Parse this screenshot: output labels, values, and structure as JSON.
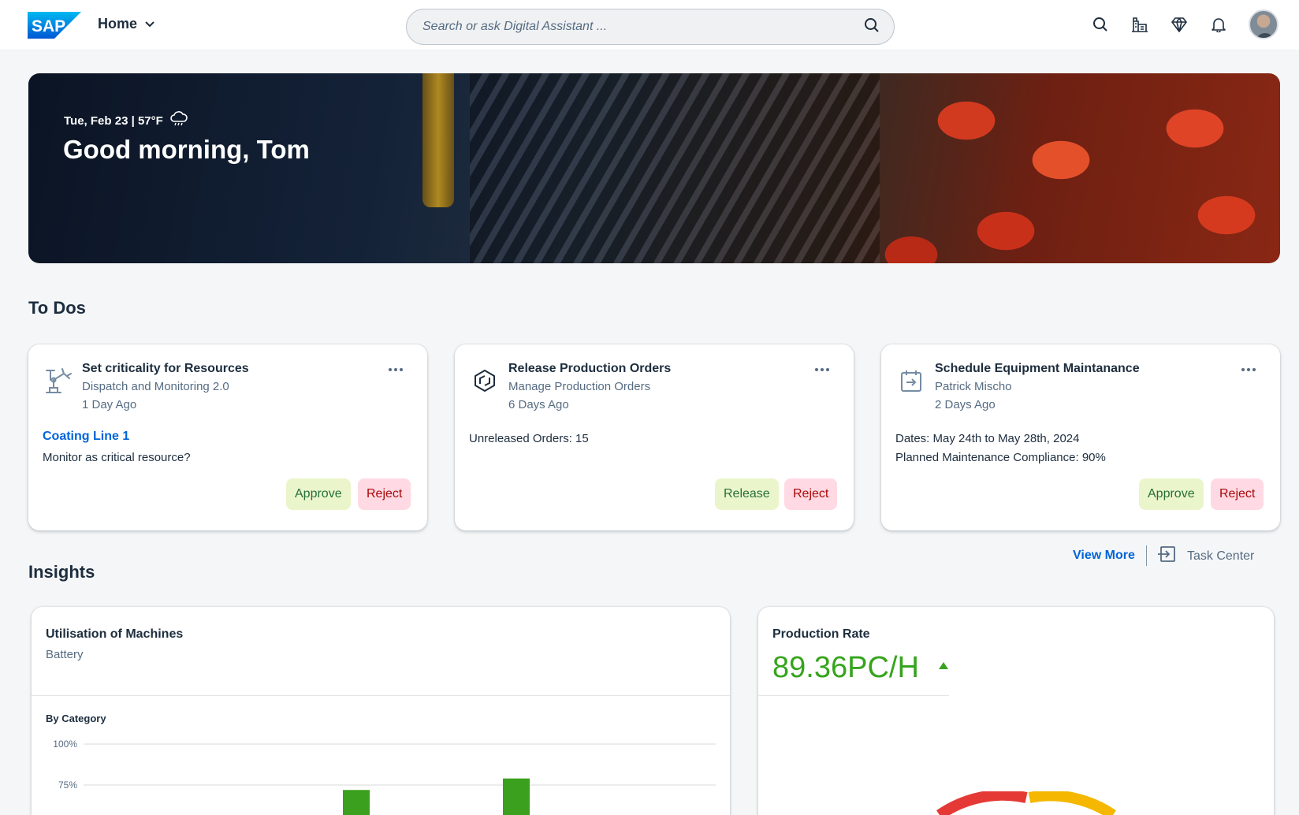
{
  "shell": {
    "logo_text": "SAP",
    "home_label": "Home",
    "search_placeholder": "Search or ask Digital Assistant ...",
    "actions": [
      "search-icon",
      "building-icon",
      "diamond-icon",
      "bell-icon"
    ]
  },
  "banner": {
    "dateline": "Tue, Feb 23 | 57°F",
    "greeting": "Good morning, Tom"
  },
  "todos": {
    "section_title": "To Dos",
    "cards": [
      {
        "title": "Set criticality for Resources",
        "subtitle": "Dispatch and Monitoring 2.0",
        "age": "1 Day Ago",
        "link": "Coating Line 1",
        "lines": [
          "Monitor as critical resource?"
        ],
        "accept_label": "Approve",
        "reject_label": "Reject"
      },
      {
        "title": "Release Production Orders",
        "subtitle": "Manage Production Orders",
        "age": "6 Days Ago",
        "lines": [
          "Unreleased Orders: 15"
        ],
        "accept_label": "Release",
        "reject_label": "Reject"
      },
      {
        "title": "Schedule Equipment Maintanance",
        "subtitle": "Patrick Mischo",
        "age": "2 Days Ago",
        "lines": [
          "Dates: May 24th to May 28th, 2024",
          "Planned Maintenance Compliance: 90%"
        ],
        "accept_label": "Approve",
        "reject_label": "Reject"
      }
    ],
    "view_more": "View More",
    "task_center": "Task Center"
  },
  "insights": {
    "section_title": "Insights",
    "utilisation": {
      "title": "Utilisation of Machines",
      "subtitle": "Battery",
      "by_category": "By Category"
    },
    "production_rate": {
      "title": "Production Rate",
      "value": "89.36PC/H",
      "trend": "up",
      "value_color": "#36a41d"
    }
  },
  "chart_data": {
    "type": "bar",
    "title": "By Category",
    "ylim": [
      0,
      100
    ],
    "yticks": [
      "100%",
      "75%"
    ],
    "ytick_values": [
      100,
      75
    ],
    "values_visible": [
      72,
      79
    ],
    "bar_color": "#3aa01d",
    "grid": true
  },
  "colors": {
    "link": "#0064d9",
    "positive": "#256f3a",
    "negative": "#aa0808",
    "gauge_red": "#e53935",
    "gauge_yellow": "#f5b700"
  }
}
